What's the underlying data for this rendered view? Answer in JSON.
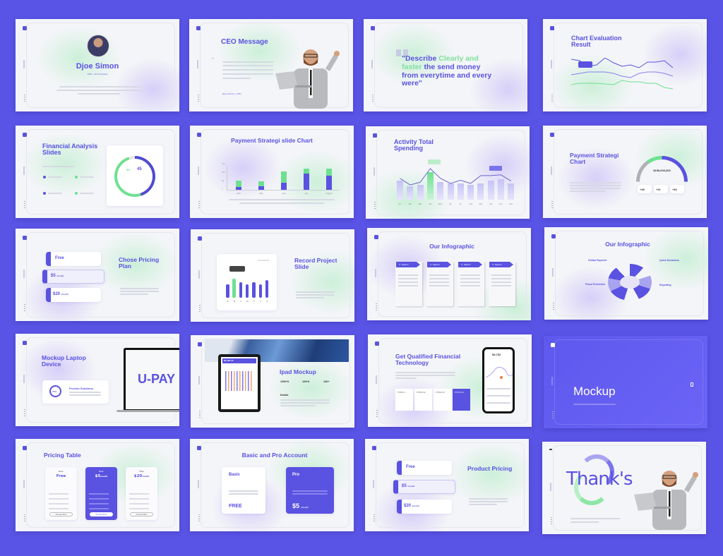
{
  "colors": {
    "background": "#5a54e6",
    "accent": "#5a52e0",
    "green": "#6ee090",
    "slide": "#f4f5f8"
  },
  "slides": [
    {
      "title": "Djoe Simon",
      "subtitle": "CEO • Of Company"
    },
    {
      "title": "CEO Message",
      "signature": "Djoe Simon | CEO",
      "quote_mark": "“"
    },
    {
      "quote_part1": "\"Describe ",
      "quote_highlight": "Clearly and faster",
      "quote_part2": " the send money from everytime and every were\""
    },
    {
      "title": "Chart Evaluation Result",
      "lines": [
        [
          60,
          58,
          50,
          52,
          62,
          55,
          50,
          52,
          48,
          56,
          56,
          58,
          48
        ],
        [
          38,
          40,
          42,
          42,
          42,
          40,
          36,
          34,
          40,
          42,
          42,
          40,
          36
        ],
        [
          24,
          26,
          26,
          26,
          25,
          24,
          30,
          28,
          28,
          26,
          26,
          20,
          18
        ]
      ]
    },
    {
      "title": "Financial Analysis Slides",
      "stat_a": "35",
      "stat_b": "45",
      "donut_percent": 45
    },
    {
      "title": "Payment Strategi slide Chart",
      "categories": [
        "April",
        "May",
        "June",
        "July",
        "August"
      ],
      "yticks": [
        "0",
        "50",
        "100",
        "150"
      ],
      "bottom": [
        15,
        20,
        40,
        95,
        85
      ],
      "top": [
        55,
        50,
        110,
        125,
        125
      ],
      "ymax": 150
    },
    {
      "title": "Activity Total Spending",
      "months": [
        "Jan",
        "Feb",
        "Mar",
        "Apr",
        "May",
        "Jun",
        "Jul",
        "Aug",
        "Sep",
        "Oct",
        "Nov",
        "Dec"
      ],
      "bars": [
        70,
        50,
        55,
        100,
        65,
        60,
        60,
        55,
        60,
        70,
        75,
        60
      ],
      "line": [
        55,
        38,
        45,
        80,
        55,
        42,
        50,
        42,
        62,
        62,
        64,
        48
      ],
      "highlight_index": 3
    },
    {
      "title": "Payment Strategi Chart",
      "amount": "$156,000,000",
      "stats": [
        "+48",
        "+21",
        "+63"
      ]
    },
    {
      "title": "Chose Pricing Plan",
      "plans": [
        {
          "price": "Free"
        },
        {
          "price": "$5",
          "per": "/month"
        },
        {
          "price": "$20",
          "per": "/month"
        }
      ]
    },
    {
      "title": "Record Project Slide",
      "days": [
        "S",
        "M",
        "T",
        "W",
        "T",
        "F",
        "S"
      ],
      "bars": [
        55,
        80,
        65,
        55,
        65,
        55,
        75
      ],
      "highlight_index": 1,
      "dropdown": "This Month"
    },
    {
      "title": "Our Infographic",
      "options": [
        "1. Option",
        "2. Option",
        "3. Option",
        "4. Option"
      ]
    },
    {
      "title": "Our Infographic",
      "labels": [
        "Global Payment",
        "Quick Donations",
        "Fraud Protection",
        "Reporting"
      ]
    },
    {
      "title": "Mockup Laptop Device",
      "feature": "Provide Solutions",
      "screen_text": "U-PAY",
      "percent": "75%"
    },
    {
      "title": "Ipad Mockup",
      "stats": [
        "1090+K",
        "100+K",
        "10K+"
      ],
      "details": "Details",
      "screen_amount": "$5,120.73"
    },
    {
      "title": "Get Qualified Financial Technology",
      "boxes": [
        "TITTLE 1",
        "TITTLE 02",
        "TITTLE 03",
        "TITTLE 04"
      ],
      "phone_amount": "$9,752"
    },
    {
      "title": "Mockup"
    },
    {
      "title": "Pricing Table",
      "plans": [
        {
          "name": "Basic",
          "price": "Free"
        },
        {
          "name": "Best",
          "price": "$5",
          "per": "/month"
        },
        {
          "name": "Tittle",
          "price": "$20",
          "per": "/month"
        }
      ],
      "button": "Choose Plan"
    },
    {
      "title": "Basic and Pro Account",
      "basic": "Basic",
      "basic_price": "FREE",
      "pro": "Pro",
      "pro_price": "$5",
      "pro_per": "/month"
    },
    {
      "title": "Product Pricing",
      "plans": [
        {
          "price": "Free"
        },
        {
          "price": "$5",
          "per": "/month"
        },
        {
          "price": "$20",
          "per": "/month"
        }
      ]
    },
    {
      "title": "Thank's"
    }
  ]
}
